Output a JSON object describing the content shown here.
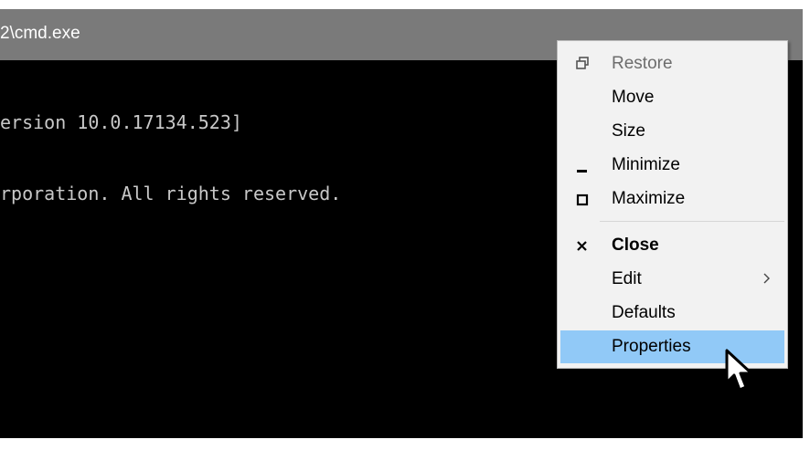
{
  "window": {
    "title": "2\\cmd.exe",
    "console_lines": [
      "ersion 10.0.17134.523]",
      "rporation. All rights reserved."
    ]
  },
  "menu": {
    "items": [
      {
        "label": "Restore",
        "icon": "restore-icon",
        "disabled": true
      },
      {
        "label": "Move"
      },
      {
        "label": "Size"
      },
      {
        "label": "Minimize",
        "icon": "minimize-icon"
      },
      {
        "label": "Maximize",
        "icon": "maximize-icon"
      },
      {
        "label": "Close",
        "icon": "close-icon",
        "bold": true
      },
      {
        "label": "Edit",
        "submenu": true
      },
      {
        "label": "Defaults"
      },
      {
        "label": "Properties",
        "highlighted": true
      }
    ]
  },
  "colors": {
    "titlebar": "#7a7a7a",
    "console_bg": "#000000",
    "console_text": "#c8c8c8",
    "menu_bg": "#f2f2f2",
    "menu_highlight": "#91c9f7",
    "disabled_text": "#6d6d6d"
  }
}
